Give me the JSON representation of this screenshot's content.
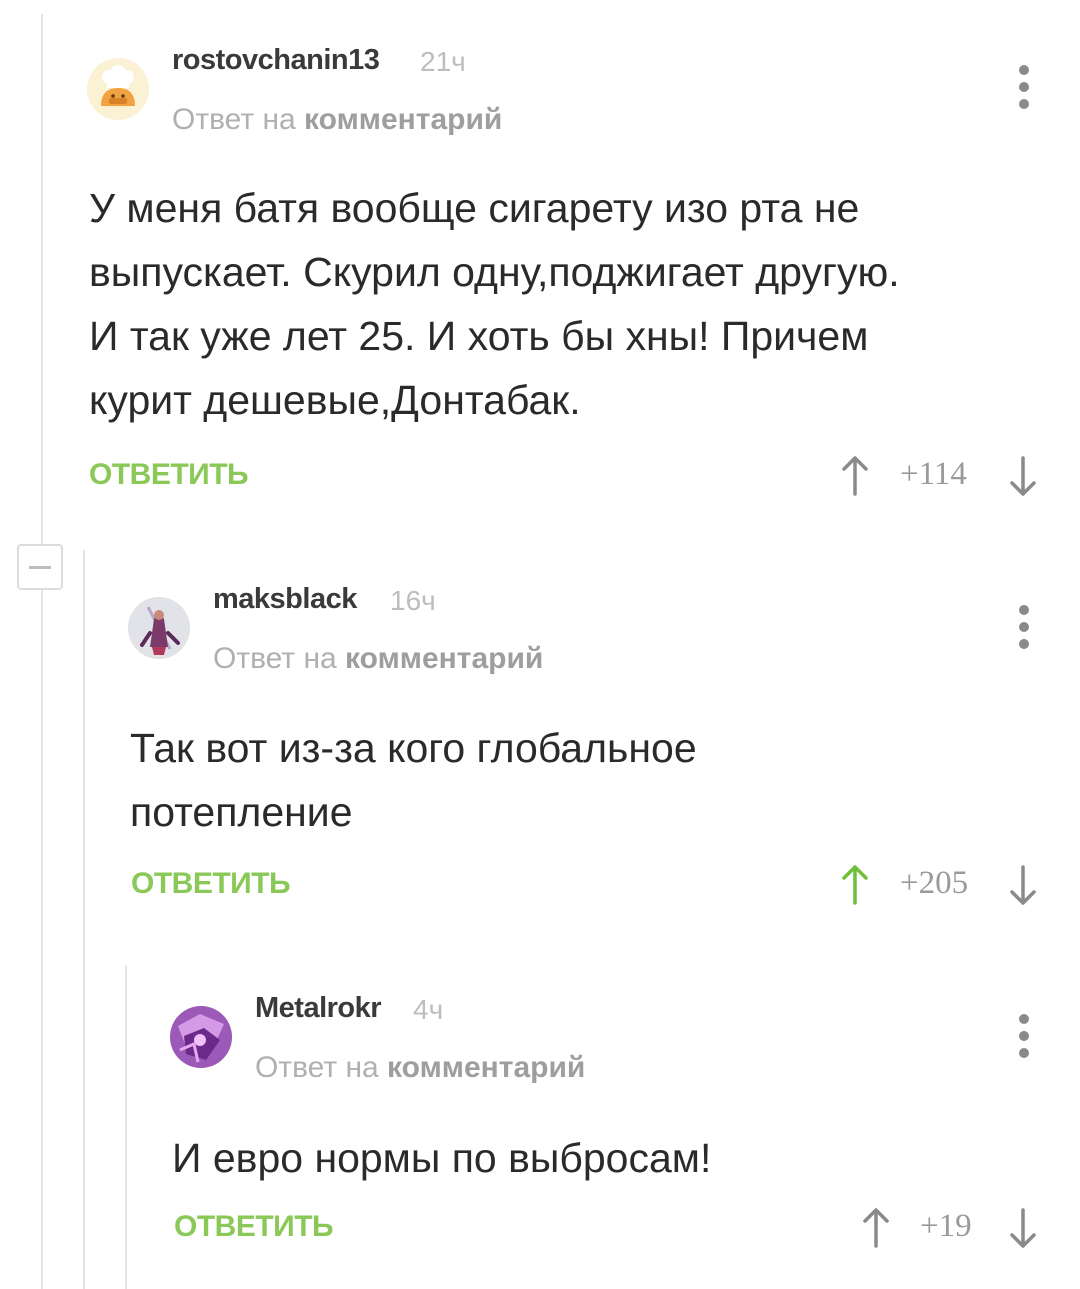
{
  "comments": [
    {
      "username": "rostovchanin13",
      "time": "21ч",
      "reply_prefix": "Ответ на",
      "reply_target": "комментарий",
      "lines": [
        "У меня батя вообще сигарету изо рта не",
        "выпускает. Скурил одну,поджигает другую.",
        "И так уже лет 25. И хоть бы хны! Причем",
        "курит дешевые,Донтабак."
      ],
      "reply_label": "ОТВЕТИТЬ",
      "rating": "+114",
      "upvoted": false,
      "avatar_icon": "chef-hat-avatar"
    },
    {
      "username": "maksblack",
      "time": "16ч",
      "reply_prefix": "Ответ на",
      "reply_target": "комментарий",
      "lines": [
        "Так вот из-за кого глобальное",
        "потепление"
      ],
      "reply_label": "ОТВЕТИТЬ",
      "rating": "+205",
      "upvoted": true,
      "avatar_icon": "warrior-avatar"
    },
    {
      "username": "Metalrokr",
      "time": "4ч",
      "reply_prefix": "Ответ на",
      "reply_target": "комментарий",
      "lines": [
        "И евро нормы по выбросам!"
      ],
      "reply_label": "ОТВЕТИТЬ",
      "rating": "+19",
      "upvoted": false,
      "avatar_icon": "purple-avatar"
    }
  ],
  "colors": {
    "accent_green": "#8ac858",
    "upvote_active": "#6fbf3a",
    "arrow_inactive": "#8a8a8a",
    "thread_line": "#e4e4e4"
  }
}
